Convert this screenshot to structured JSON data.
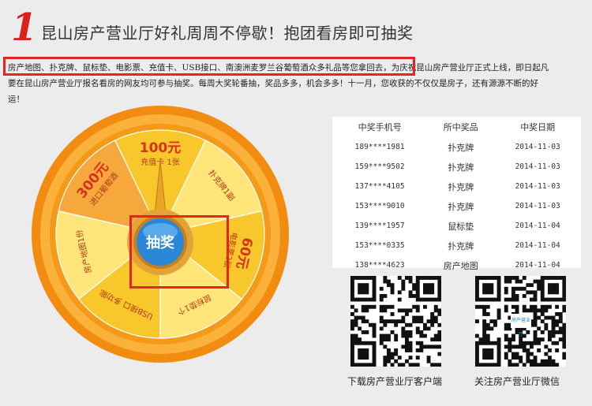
{
  "header": {
    "badge_number": "1",
    "title": "昆山房产营业厅好礼周周不停歇！抱团看房即可抽奖"
  },
  "intro": {
    "line1": "房产地图、扑克牌、鼠标垫、电影票、充值卡、USB接口、南澳洲麦罗兰谷葡萄酒众多礼品等您拿回去，为庆祝昆山房产营业厅正式上线，即日起凡",
    "line2": "要在昆山房产营业厅报名看房的网友均可参与抽奖。每周大奖轮番抽，奖品多多，机会多多！十一月，您收获的不仅仅是房子，还有源源不断的好",
    "line3": "运！"
  },
  "wheel": {
    "center_label": "抽奖",
    "prizes": [
      {
        "big": "100元",
        "small": "充值卡 1张"
      },
      {
        "big": "",
        "small": "扑克牌1副"
      },
      {
        "big": "60元",
        "small": "电影票2张"
      },
      {
        "big": "",
        "small": "鼠标垫1个"
      },
      {
        "big": "",
        "small": "USB接口 多功能"
      },
      {
        "big": "",
        "small": "房产地图1份"
      },
      {
        "big": "300元",
        "small": "进口葡萄酒"
      }
    ],
    "colors": {
      "rim": "#f39a12",
      "segment_light": "#ffe57a",
      "segment_dark": "#f7c72c",
      "accent_red": "#d8321d",
      "button_blue": "#2a86d6"
    }
  },
  "winners": {
    "headers": [
      "中奖手机号",
      "所中奖品",
      "中奖日期"
    ],
    "rows": [
      {
        "phone": "189****1981",
        "prize": "扑克牌",
        "date": "2014-11-03"
      },
      {
        "phone": "159****9502",
        "prize": "扑克牌",
        "date": "2014-11-03"
      },
      {
        "phone": "137****4105",
        "prize": "扑克牌",
        "date": "2014-11-03"
      },
      {
        "phone": "153****9010",
        "prize": "扑克牌",
        "date": "2014-11-03"
      },
      {
        "phone": "139****1957",
        "prize": "鼠标垫",
        "date": "2014-11-04"
      },
      {
        "phone": "153****0335",
        "prize": "扑克牌",
        "date": "2014-11-04"
      },
      {
        "phone": "138****4623",
        "prize": "房产地图",
        "date": "2014-11-04"
      }
    ]
  },
  "qr": {
    "app_caption": "下载房产营业厅客户端",
    "wechat_caption": "关注房产营业厅微信",
    "wechat_logo_text": "房产营业厅"
  }
}
